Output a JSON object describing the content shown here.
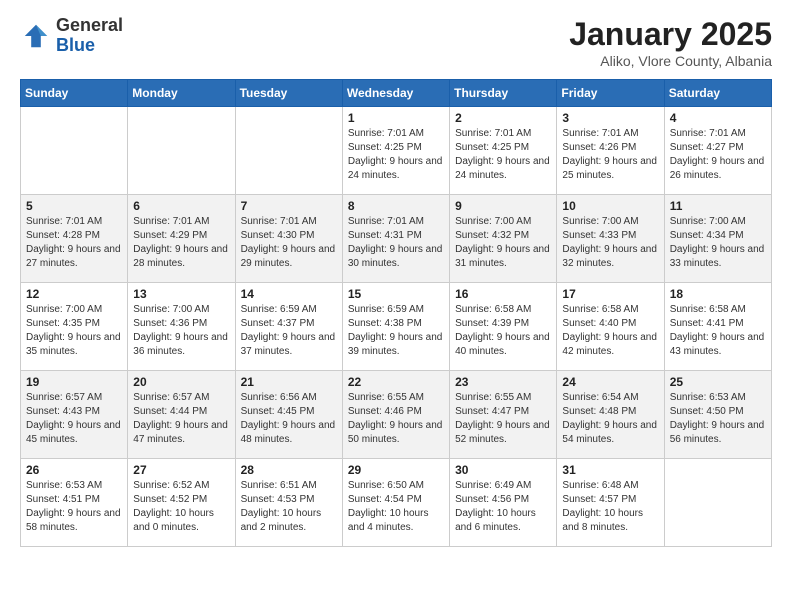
{
  "logo": {
    "general": "General",
    "blue": "Blue"
  },
  "header": {
    "month_year": "January 2025",
    "location": "Aliko, Vlore County, Albania"
  },
  "weekdays": [
    "Sunday",
    "Monday",
    "Tuesday",
    "Wednesday",
    "Thursday",
    "Friday",
    "Saturday"
  ],
  "weeks": [
    [
      {
        "day": "",
        "sunrise": "",
        "sunset": "",
        "daylight": ""
      },
      {
        "day": "",
        "sunrise": "",
        "sunset": "",
        "daylight": ""
      },
      {
        "day": "",
        "sunrise": "",
        "sunset": "",
        "daylight": ""
      },
      {
        "day": "1",
        "sunrise": "Sunrise: 7:01 AM",
        "sunset": "Sunset: 4:25 PM",
        "daylight": "Daylight: 9 hours and 24 minutes."
      },
      {
        "day": "2",
        "sunrise": "Sunrise: 7:01 AM",
        "sunset": "Sunset: 4:25 PM",
        "daylight": "Daylight: 9 hours and 24 minutes."
      },
      {
        "day": "3",
        "sunrise": "Sunrise: 7:01 AM",
        "sunset": "Sunset: 4:26 PM",
        "daylight": "Daylight: 9 hours and 25 minutes."
      },
      {
        "day": "4",
        "sunrise": "Sunrise: 7:01 AM",
        "sunset": "Sunset: 4:27 PM",
        "daylight": "Daylight: 9 hours and 26 minutes."
      }
    ],
    [
      {
        "day": "5",
        "sunrise": "Sunrise: 7:01 AM",
        "sunset": "Sunset: 4:28 PM",
        "daylight": "Daylight: 9 hours and 27 minutes."
      },
      {
        "day": "6",
        "sunrise": "Sunrise: 7:01 AM",
        "sunset": "Sunset: 4:29 PM",
        "daylight": "Daylight: 9 hours and 28 minutes."
      },
      {
        "day": "7",
        "sunrise": "Sunrise: 7:01 AM",
        "sunset": "Sunset: 4:30 PM",
        "daylight": "Daylight: 9 hours and 29 minutes."
      },
      {
        "day": "8",
        "sunrise": "Sunrise: 7:01 AM",
        "sunset": "Sunset: 4:31 PM",
        "daylight": "Daylight: 9 hours and 30 minutes."
      },
      {
        "day": "9",
        "sunrise": "Sunrise: 7:00 AM",
        "sunset": "Sunset: 4:32 PM",
        "daylight": "Daylight: 9 hours and 31 minutes."
      },
      {
        "day": "10",
        "sunrise": "Sunrise: 7:00 AM",
        "sunset": "Sunset: 4:33 PM",
        "daylight": "Daylight: 9 hours and 32 minutes."
      },
      {
        "day": "11",
        "sunrise": "Sunrise: 7:00 AM",
        "sunset": "Sunset: 4:34 PM",
        "daylight": "Daylight: 9 hours and 33 minutes."
      }
    ],
    [
      {
        "day": "12",
        "sunrise": "Sunrise: 7:00 AM",
        "sunset": "Sunset: 4:35 PM",
        "daylight": "Daylight: 9 hours and 35 minutes."
      },
      {
        "day": "13",
        "sunrise": "Sunrise: 7:00 AM",
        "sunset": "Sunset: 4:36 PM",
        "daylight": "Daylight: 9 hours and 36 minutes."
      },
      {
        "day": "14",
        "sunrise": "Sunrise: 6:59 AM",
        "sunset": "Sunset: 4:37 PM",
        "daylight": "Daylight: 9 hours and 37 minutes."
      },
      {
        "day": "15",
        "sunrise": "Sunrise: 6:59 AM",
        "sunset": "Sunset: 4:38 PM",
        "daylight": "Daylight: 9 hours and 39 minutes."
      },
      {
        "day": "16",
        "sunrise": "Sunrise: 6:58 AM",
        "sunset": "Sunset: 4:39 PM",
        "daylight": "Daylight: 9 hours and 40 minutes."
      },
      {
        "day": "17",
        "sunrise": "Sunrise: 6:58 AM",
        "sunset": "Sunset: 4:40 PM",
        "daylight": "Daylight: 9 hours and 42 minutes."
      },
      {
        "day": "18",
        "sunrise": "Sunrise: 6:58 AM",
        "sunset": "Sunset: 4:41 PM",
        "daylight": "Daylight: 9 hours and 43 minutes."
      }
    ],
    [
      {
        "day": "19",
        "sunrise": "Sunrise: 6:57 AM",
        "sunset": "Sunset: 4:43 PM",
        "daylight": "Daylight: 9 hours and 45 minutes."
      },
      {
        "day": "20",
        "sunrise": "Sunrise: 6:57 AM",
        "sunset": "Sunset: 4:44 PM",
        "daylight": "Daylight: 9 hours and 47 minutes."
      },
      {
        "day": "21",
        "sunrise": "Sunrise: 6:56 AM",
        "sunset": "Sunset: 4:45 PM",
        "daylight": "Daylight: 9 hours and 48 minutes."
      },
      {
        "day": "22",
        "sunrise": "Sunrise: 6:55 AM",
        "sunset": "Sunset: 4:46 PM",
        "daylight": "Daylight: 9 hours and 50 minutes."
      },
      {
        "day": "23",
        "sunrise": "Sunrise: 6:55 AM",
        "sunset": "Sunset: 4:47 PM",
        "daylight": "Daylight: 9 hours and 52 minutes."
      },
      {
        "day": "24",
        "sunrise": "Sunrise: 6:54 AM",
        "sunset": "Sunset: 4:48 PM",
        "daylight": "Daylight: 9 hours and 54 minutes."
      },
      {
        "day": "25",
        "sunrise": "Sunrise: 6:53 AM",
        "sunset": "Sunset: 4:50 PM",
        "daylight": "Daylight: 9 hours and 56 minutes."
      }
    ],
    [
      {
        "day": "26",
        "sunrise": "Sunrise: 6:53 AM",
        "sunset": "Sunset: 4:51 PM",
        "daylight": "Daylight: 9 hours and 58 minutes."
      },
      {
        "day": "27",
        "sunrise": "Sunrise: 6:52 AM",
        "sunset": "Sunset: 4:52 PM",
        "daylight": "Daylight: 10 hours and 0 minutes."
      },
      {
        "day": "28",
        "sunrise": "Sunrise: 6:51 AM",
        "sunset": "Sunset: 4:53 PM",
        "daylight": "Daylight: 10 hours and 2 minutes."
      },
      {
        "day": "29",
        "sunrise": "Sunrise: 6:50 AM",
        "sunset": "Sunset: 4:54 PM",
        "daylight": "Daylight: 10 hours and 4 minutes."
      },
      {
        "day": "30",
        "sunrise": "Sunrise: 6:49 AM",
        "sunset": "Sunset: 4:56 PM",
        "daylight": "Daylight: 10 hours and 6 minutes."
      },
      {
        "day": "31",
        "sunrise": "Sunrise: 6:48 AM",
        "sunset": "Sunset: 4:57 PM",
        "daylight": "Daylight: 10 hours and 8 minutes."
      },
      {
        "day": "",
        "sunrise": "",
        "sunset": "",
        "daylight": ""
      }
    ]
  ]
}
